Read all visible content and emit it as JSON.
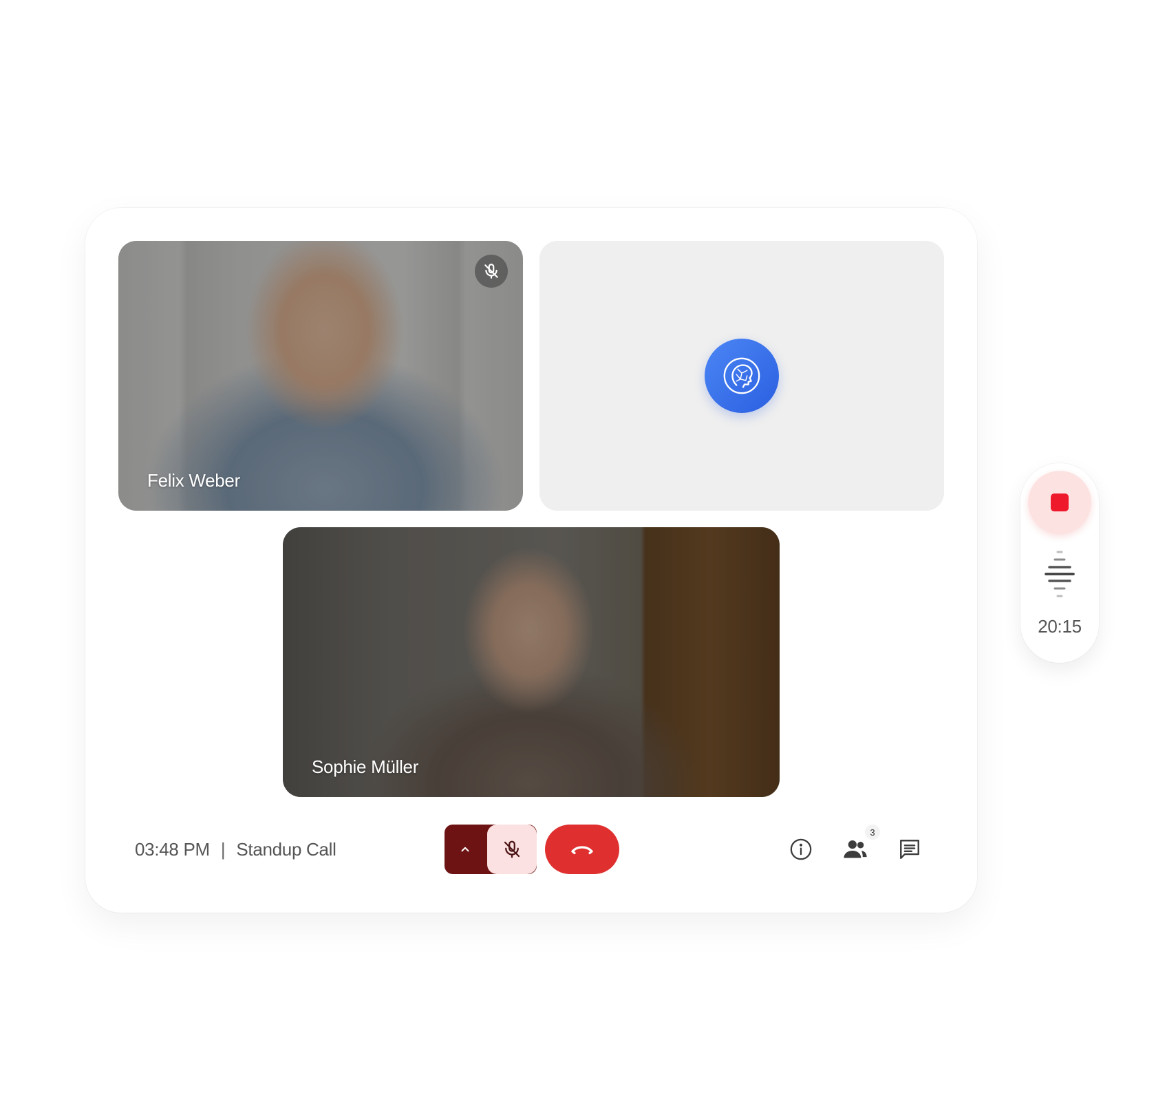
{
  "participants": [
    {
      "name": "Felix Weber",
      "muted": true
    },
    {
      "name": "Sophie Müller",
      "muted": false
    }
  ],
  "assistant": {
    "icon": "ai-assistant-head-icon"
  },
  "toolbar": {
    "time": "03:48 PM",
    "separator": "|",
    "meeting_title": "Standup Call",
    "people_count": "3"
  },
  "recording": {
    "timer": "20:15"
  },
  "colors": {
    "mic_group_dark": "#6e1313",
    "mic_muted_bg": "#fbe1e1",
    "end_call": "#df2f2f",
    "record_stop": "#ee1a2b",
    "assistant_blue": "#2a5fe0"
  }
}
